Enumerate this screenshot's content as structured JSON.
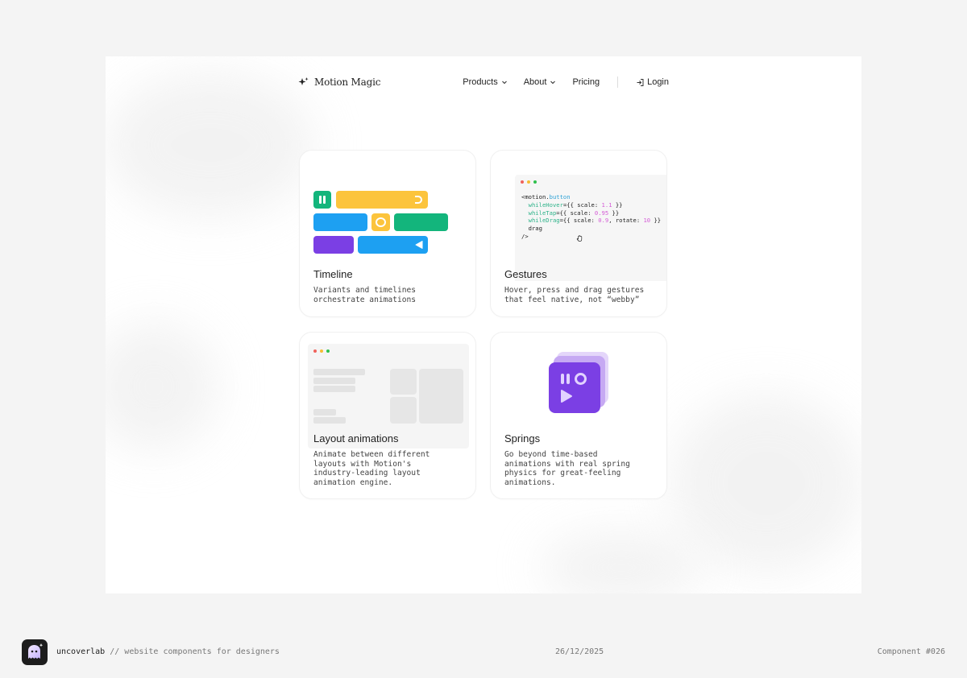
{
  "nav": {
    "brand": "Motion Magic",
    "items": [
      {
        "label": "Products"
      },
      {
        "label": "About"
      },
      {
        "label": "Pricing"
      }
    ],
    "login": "Login"
  },
  "cards": [
    {
      "title": "Timeline",
      "desc": "Variants and timelines\norchestrate animations"
    },
    {
      "title": "Gestures",
      "desc": "Hover, press and drag gestures\nthat feel native, not “webby”"
    },
    {
      "title": "Layout animations",
      "desc": "Animate between different\nlayouts with Motion's\nindustry-leading layout\nanimation engine."
    },
    {
      "title": "Springs",
      "desc": "Go beyond time-based\nanimations with real spring\nphysics for great-feeling\nanimations."
    }
  ],
  "code": {
    "tag_open": "<motion.",
    "tag_name": "button",
    "hover_attr": "whileHover",
    "hover_val": "1.1",
    "tap_attr": "whileTap",
    "tap_val": "0.95",
    "drag_attr": "whileDrag",
    "drag_scale": "0.9",
    "drag_rotate": "10",
    "drag_word": "drag",
    "close": "/>",
    "scale_key": "scale: ",
    "rotate_key": "rotate: "
  },
  "footer": {
    "brand": "uncoverlab",
    "tagline": " // website components for designers",
    "date": "26/12/2025",
    "component": "Component #026"
  },
  "colors": {
    "yellow": "#fcc43c",
    "green": "#13b57c",
    "blue": "#1da0f2",
    "purple": "#7b3fe4",
    "dot_red": "#f0625b",
    "dot_yellow": "#f6bd34",
    "dot_green": "#2fc04d"
  }
}
